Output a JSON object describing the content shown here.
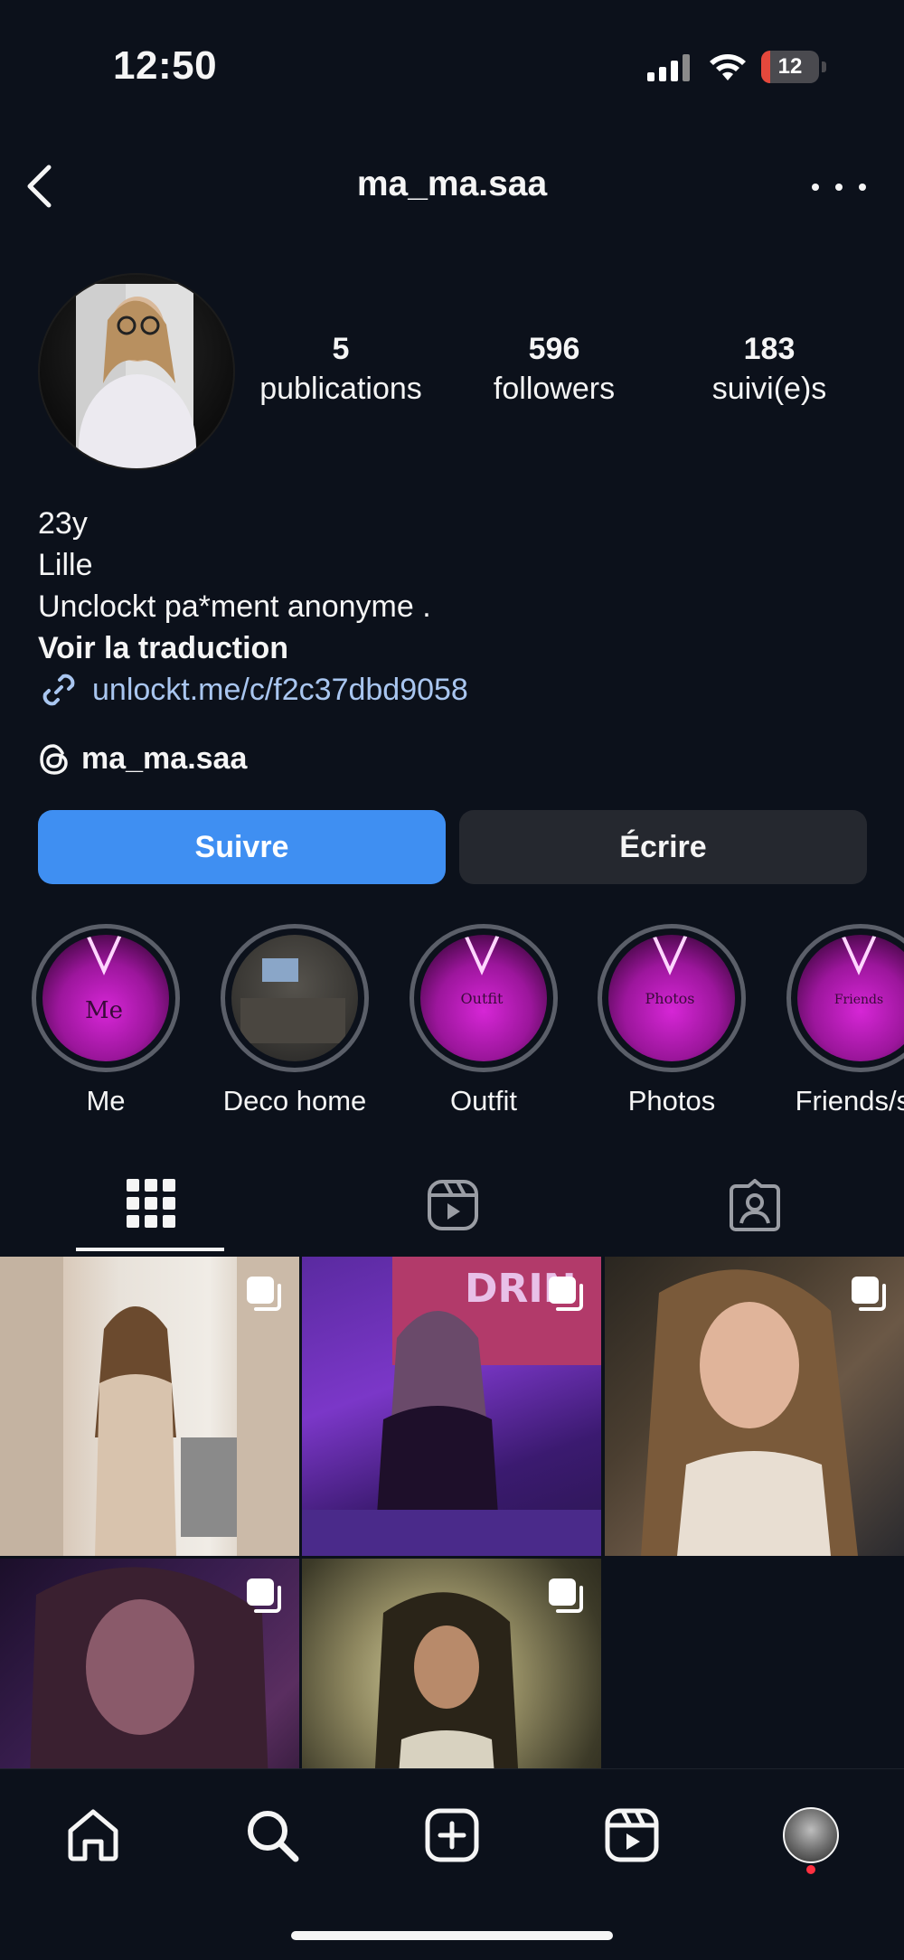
{
  "status_bar": {
    "time": "12:50",
    "battery": "12"
  },
  "header": {
    "username": "ma_ma.saa"
  },
  "stats": [
    {
      "value": "5",
      "label": "publications"
    },
    {
      "value": "596",
      "label": "followers"
    },
    {
      "value": "183",
      "label": "suivi(e)s"
    }
  ],
  "bio": {
    "lines": [
      "23y",
      "Lille",
      "Unclockt pa*ment anonyme ."
    ],
    "translate": "Voir la traduction",
    "link": "unlockt.me/c/f2c37dbd9058",
    "threads": "ma_ma.saa"
  },
  "actions": {
    "follow": "Suivre",
    "message": "Écrire"
  },
  "highlights": [
    {
      "label": "Me",
      "cover_text": "Me"
    },
    {
      "label": "Deco home",
      "cover_text": ""
    },
    {
      "label": "Outfit",
      "cover_text": "Outfit"
    },
    {
      "label": "Photos",
      "cover_text": "Photos"
    },
    {
      "label": "Friends/so",
      "cover_text": "Friends"
    }
  ],
  "colors": {
    "follow_button": "#3f8ff2",
    "background": "#0c111b",
    "link": "#a9c6f0",
    "notification_dot": "#ff3040"
  },
  "icons": {
    "tabs": [
      "grid-icon",
      "reels-icon",
      "tagged-icon"
    ],
    "nav": [
      "home-icon",
      "search-icon",
      "create-icon",
      "reels-icon",
      "profile-avatar"
    ]
  }
}
